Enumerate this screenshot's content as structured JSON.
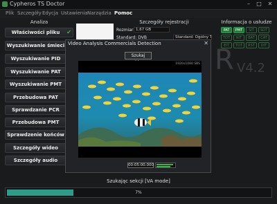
{
  "window": {
    "title": "Cypheros TS Doctor",
    "controls": [
      "–",
      "□",
      "✕"
    ]
  },
  "menu": {
    "items": [
      "Plik",
      "Szczegóły",
      "Edycja",
      "Ustawienia",
      "Narzędzia",
      "Pomoc"
    ],
    "active": "Pomoc"
  },
  "analysis": {
    "title": "Analiza",
    "buttons": [
      "Właściwości pliku",
      "Wyszukiwanie śmieci",
      "Wyszukiwanie PID",
      "Wyszukiwanie PAT",
      "Wyszukiwanie PMT",
      "Przebudowa PAT",
      "Sprawdzanie PCR",
      "Przebudowa PMT",
      "Sprawdzenie końców",
      "Szczegóły wideo",
      "Szczegóły audio"
    ]
  },
  "registration": {
    "title": "Szczegóły rejestracji",
    "size_label": "Rozmiar:",
    "size_value": "1,67 GB",
    "standard_label": "Standard: DVB",
    "standard_value": "Standard: Ogólny TS"
  },
  "service_info": {
    "title": "Informacja o usłudze",
    "badges": [
      {
        "label": "PAT",
        "on": true
      },
      {
        "label": "PMT",
        "on": true
      },
      {
        "label": "SIT",
        "on": false
      },
      {
        "label": "SDT",
        "on": false
      },
      {
        "label": "TDT",
        "on": false
      },
      {
        "label": "NIT",
        "on": false
      },
      {
        "label": "BAT",
        "on": false
      },
      {
        "label": "CAT",
        "on": false
      },
      {
        "label": "EIT",
        "on": false
      },
      {
        "label": "TOT",
        "on": false
      },
      {
        "label": "RST",
        "on": false
      },
      {
        "label": "DIT",
        "on": false
      }
    ]
  },
  "logo": {
    "letter": "R",
    "version": "V4.2"
  },
  "dialog": {
    "title": "Video Analysis Commercials Detection",
    "close": "✕",
    "scan_button": "Szukaj reklam",
    "resolution": "1920x1080 SBS",
    "timecode": "00:05:00.000",
    "meters": {
      "level1": 0.85,
      "level2": 0.7
    }
  },
  "status": {
    "text": "Szukając sekcji [VA mode]",
    "progress_percent": 7,
    "progress_label": "7%"
  },
  "colors": {
    "accent": "#2e9c8a",
    "check": "#37b24d",
    "badge_on": "#1f7a39"
  }
}
